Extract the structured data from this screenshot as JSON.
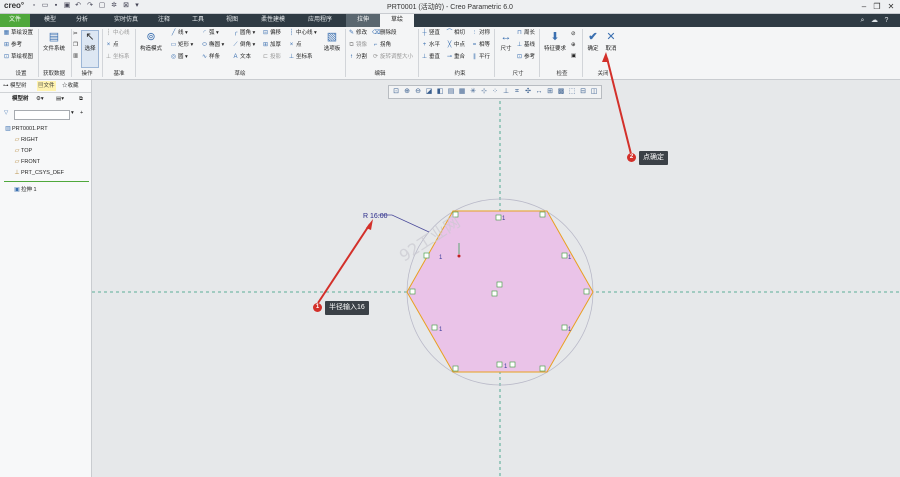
{
  "titlebar": {
    "logo": "creo°",
    "window_title": "PRT0001 (活动的) - Creo Parametric 6.0"
  },
  "tabs": {
    "file": "文件",
    "items": [
      "模型",
      "分析",
      "实时仿真",
      "注释",
      "工具",
      "视图",
      "柔性建模",
      "应用程序"
    ],
    "extrude": "拉伸",
    "sketch": "草绘"
  },
  "ribbon": {
    "setup": {
      "sketch_setup": "草绘设置",
      "reference": "参考",
      "sketch_view": "草绘视图",
      "group": "设置"
    },
    "get_data": {
      "file_system": "文件系统",
      "group": "获取数据"
    },
    "operations": {
      "select": "选择",
      "group": "操作"
    },
    "datum": {
      "centerline": "中心线",
      "point": "点",
      "csys": "坐标系",
      "group": "基准"
    },
    "construction": "构造模式",
    "sketching": {
      "line": "线",
      "arc": "弧",
      "rectangle": "矩形",
      "ellipse": "椭圆",
      "circle": "圆",
      "fillet": "圆角",
      "chamfer": "倒角",
      "offset": "偏移",
      "thicken": "加厚",
      "spline": "样条",
      "text": "文本",
      "centerline": "中心线",
      "point": "点",
      "csys": "坐标系",
      "project": "投影",
      "palette": "选项板",
      "group": "草绘"
    },
    "editing": {
      "modify": "修改",
      "mirror": "镜像",
      "divide": "分割",
      "delete_segment": "删除段",
      "corner": "拐角",
      "rotate_resize": "旋转调整大小",
      "group": "编辑"
    },
    "constrain": {
      "vertical": "竖直",
      "horizontal": "水平",
      "perpendicular": "垂直",
      "tangent": "相切",
      "midpoint": "中点",
      "coincident": "重合",
      "symmetric": "对称",
      "equal": "相等",
      "parallel": "平行",
      "group": "约束"
    },
    "dimension": {
      "dimension": "尺寸",
      "perimeter": "周长",
      "baseline": "基线",
      "reference": "参考",
      "group": "尺寸"
    },
    "inspect": {
      "feature_req": "特征要求",
      "group": "检查"
    },
    "close": {
      "ok": "确定",
      "cancel": "取消",
      "group": "关闭"
    }
  },
  "left_panel": {
    "tabs": [
      "模型树",
      "文件",
      "收藏"
    ],
    "toolbar_label": "模型树",
    "tree": [
      "PRT0001.PRT",
      "RIGHT",
      "TOP",
      "FRONT",
      "PRT_CSYS_DEF"
    ],
    "feature": "拉伸 1"
  },
  "canvas": {
    "dimension_label": "R 16.00",
    "watermark": "92工业网",
    "constraint_tag": "1",
    "callout_radius": "半径输入16",
    "callout_ok": "点确定",
    "badge_1": "1",
    "badge_2": "2",
    "fill_color": "#eac3e8",
    "highlight_color": "#e8a020",
    "annotation_color": "#d3302a"
  }
}
